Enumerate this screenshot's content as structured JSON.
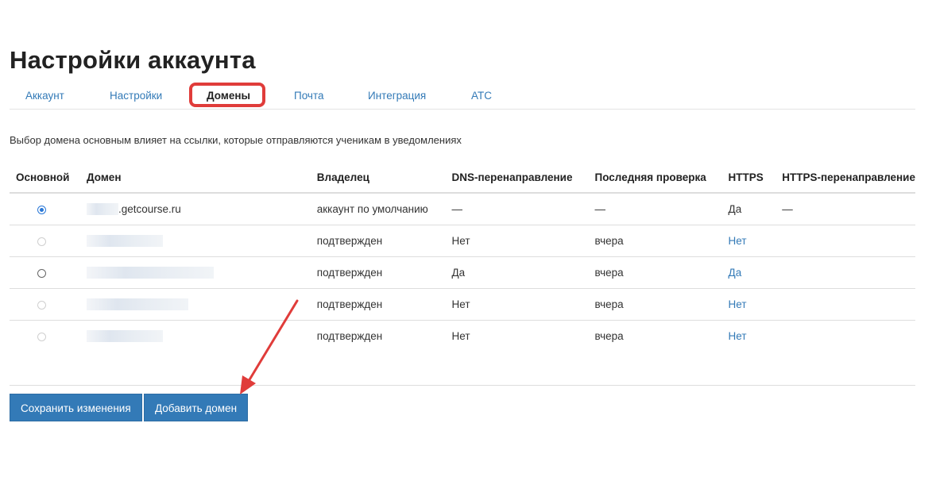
{
  "page": {
    "title": "Настройки аккаунта"
  },
  "tabs": [
    {
      "label": "Аккаунт",
      "active": false
    },
    {
      "label": "Настройки",
      "active": false
    },
    {
      "label": "Домены",
      "active": true
    },
    {
      "label": "Почта",
      "active": false
    },
    {
      "label": "Интеграция",
      "active": false
    },
    {
      "label": "АТС",
      "active": false
    }
  ],
  "info_text": "Выбор домена основным влияет на ссылки, которые отправляются ученикам в уведомлениях",
  "table": {
    "columns": [
      "Основной",
      "Домен",
      "Владелец",
      "DNS-перенаправление",
      "Последняя проверка",
      "HTTPS",
      "HTTPS-перенаправление"
    ],
    "rows": [
      {
        "primary": true,
        "radio_enabled": true,
        "domain": ".getcourse.ru",
        "owner": "аккаунт по умолчанию",
        "dns": "—",
        "last_check": "—",
        "https": "Да",
        "https_redirect": "—"
      },
      {
        "primary": false,
        "radio_enabled": false,
        "domain": "",
        "owner": "подтвержден",
        "dns": "Нет",
        "last_check": "вчера",
        "https": "Нет",
        "https_redirect": ""
      },
      {
        "primary": false,
        "radio_enabled": true,
        "domain": "",
        "owner": "подтвержден",
        "dns": "Да",
        "last_check": "вчера",
        "https": "Да",
        "https_redirect": ""
      },
      {
        "primary": false,
        "radio_enabled": false,
        "domain": "",
        "owner": "подтвержден",
        "dns": "Нет",
        "last_check": "вчера",
        "https": "Нет",
        "https_redirect": ""
      },
      {
        "primary": false,
        "radio_enabled": false,
        "domain": "",
        "owner": "подтвержден",
        "dns": "Нет",
        "last_check": "вчера",
        "https": "Нет",
        "https_redirect": ""
      }
    ]
  },
  "buttons": {
    "save": "Сохранить изменения",
    "add_domain": "Добавить домен"
  },
  "colors": {
    "link": "#337ab7",
    "button": "#337ab7",
    "highlight": "#e03c3a",
    "radio_checked": "#2a78d7"
  }
}
